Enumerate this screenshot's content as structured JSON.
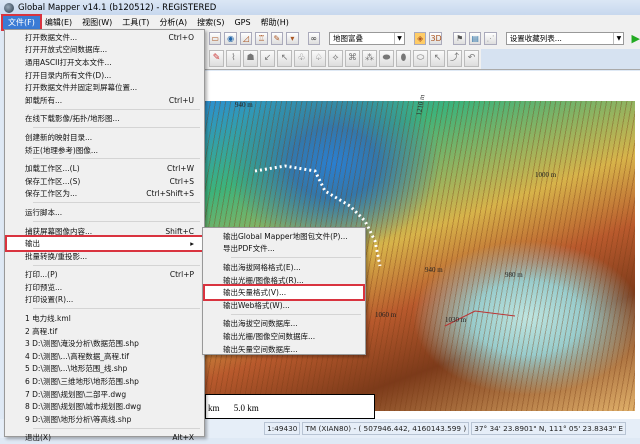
{
  "window": {
    "title": "Global Mapper v14.1 (b120512) - REGISTERED"
  },
  "menubar": [
    "文件(F)",
    "编辑(E)",
    "视图(W)",
    "工具(T)",
    "分析(A)",
    "搜索(S)",
    "GPS",
    "帮助(H)"
  ],
  "toolbar": {
    "layer_combo": "地图富叠",
    "favorites_combo": "设置收藏列表..."
  },
  "file_menu": {
    "groups": [
      [
        {
          "label": "打开数据文件...",
          "shortcut": "Ctrl+O"
        },
        {
          "label": "打开开放式空间数据库...",
          "shortcut": ""
        },
        {
          "label": "通用ASCII打开文本文件...",
          "shortcut": ""
        },
        {
          "label": "打开目录内所有文件(D)...",
          "shortcut": ""
        },
        {
          "label": "打开数据文件并固定到屏幕位置...",
          "shortcut": ""
        },
        {
          "label": "卸载所有...",
          "shortcut": "Ctrl+U"
        }
      ],
      [
        {
          "label": "在线下载影像/拓扑/地形图...",
          "shortcut": ""
        }
      ],
      [
        {
          "label": "创建新的映射目录...",
          "shortcut": ""
        },
        {
          "label": "矫正(地理参考)图像...",
          "shortcut": ""
        }
      ],
      [
        {
          "label": "加载工作区...(L)",
          "shortcut": "Ctrl+W"
        },
        {
          "label": "保存工作区...(S)",
          "shortcut": "Ctrl+S"
        },
        {
          "label": "保存工作区为...",
          "shortcut": "Ctrl+Shift+S"
        }
      ],
      [
        {
          "label": "运行脚本...",
          "shortcut": ""
        }
      ],
      [
        {
          "label": "捕获屏幕图像内容...",
          "shortcut": "Shift+C"
        },
        {
          "label": "输出",
          "shortcut": "▸",
          "highlight": true
        },
        {
          "label": "批量转换/重投影...",
          "shortcut": ""
        }
      ],
      [
        {
          "label": "打印...(P)",
          "shortcut": "Ctrl+P"
        },
        {
          "label": "打印预览...",
          "shortcut": ""
        },
        {
          "label": "打印设置(R)...",
          "shortcut": ""
        }
      ],
      [
        {
          "label": "1 电力线.kml",
          "shortcut": ""
        },
        {
          "label": "2 高程.tif",
          "shortcut": ""
        },
        {
          "label": "3 D:\\测图\\淹没分析\\数据范围.shp",
          "shortcut": ""
        },
        {
          "label": "4 D:\\测图\\...\\高程数据_高程.tif",
          "shortcut": ""
        },
        {
          "label": "5 D:\\测图\\...\\地形范围_线.shp",
          "shortcut": ""
        },
        {
          "label": "6 D:\\测图\\三维地形\\地形范围.shp",
          "shortcut": ""
        },
        {
          "label": "7 D:\\测图\\规划图\\二部平.dwg",
          "shortcut": ""
        },
        {
          "label": "8 D:\\测图\\规划图\\城市规划图.dwg",
          "shortcut": ""
        },
        {
          "label": "9 D:\\测图\\地形分析\\等高线.shp",
          "shortcut": ""
        }
      ],
      [
        {
          "label": "退出(X)",
          "shortcut": "Alt+X"
        }
      ]
    ]
  },
  "export_submenu": {
    "groups": [
      [
        {
          "label": "输出Global Mapper地图包文件(P)..."
        },
        {
          "label": "导出PDF文件..."
        }
      ],
      [
        {
          "label": "输出海拔网格格式(E)..."
        },
        {
          "label": "输出光栅/图像格式(R)..."
        },
        {
          "label": "输出矢量格式(V)...",
          "highlight": true
        },
        {
          "label": "输出Web格式(W)..."
        }
      ],
      [
        {
          "label": "输出海拔空间数据库..."
        },
        {
          "label": "输出光栅/图像空间数据库..."
        },
        {
          "label": "输出矢量空间数据库..."
        }
      ]
    ]
  },
  "map": {
    "contour_labels": [
      "940 m",
      "1210 m",
      "1060 m",
      "1030 m",
      "980 m",
      "940 m",
      "1000 m"
    ],
    "scale_left": "km",
    "scale_right": "5.0 km"
  },
  "status": {
    "scale": "1:49430",
    "projection": "TM (XIAN80) - ( 507946.442, 4160143.599 )",
    "latlon": "37° 34' 23.8901\" N, 111° 05' 23.8343\" E"
  }
}
